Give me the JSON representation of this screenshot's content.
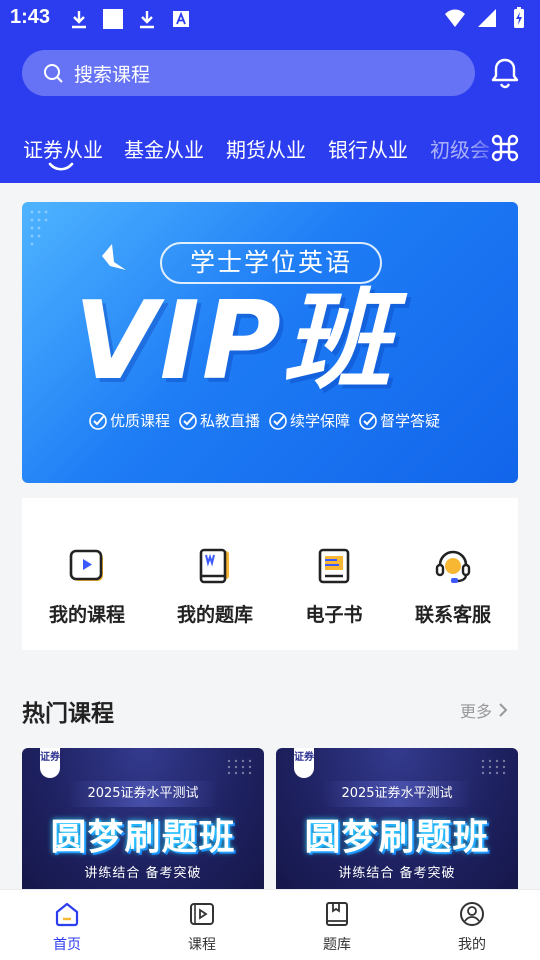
{
  "status_bar": {
    "time": "1:43",
    "left_icons": [
      "download-icon",
      "square-icon",
      "download-icon",
      "a-icon"
    ],
    "right_icons": [
      "wifi-icon",
      "signal-icon",
      "battery-charging-icon"
    ]
  },
  "search": {
    "placeholder": "搜索课程",
    "icon": "search-icon"
  },
  "notification_icon": "bell-icon",
  "category_tabs": [
    {
      "label": "证券从业",
      "active": true
    },
    {
      "label": "基金从业",
      "active": false
    },
    {
      "label": "期货从业",
      "active": false
    },
    {
      "label": "银行从业",
      "active": false
    },
    {
      "label": "初级会",
      "active": false
    }
  ],
  "all_categories_icon": "command-grid-icon",
  "banner": {
    "pill_text": "学士学位英语",
    "main_text": "VIP班",
    "features": [
      "优质课程",
      "私教直播",
      "续学保障",
      "督学答疑"
    ]
  },
  "quick_links": [
    {
      "label": "我的课程",
      "icon": "video-course-icon"
    },
    {
      "label": "我的题库",
      "icon": "question-book-icon"
    },
    {
      "label": "电子书",
      "icon": "ebook-icon"
    },
    {
      "label": "联系客服",
      "icon": "headset-icon"
    }
  ],
  "hot_courses": {
    "title": "热门课程",
    "more_label": "更多",
    "items": [
      {
        "tag": "证券",
        "subtitle": "2025证券水平测试",
        "title": "圆梦刷题班",
        "footer": "讲练结合  备考突破"
      },
      {
        "tag": "证券",
        "subtitle": "2025证券水平测试",
        "title": "圆梦刷题班",
        "footer": "讲练结合  备考突破"
      }
    ]
  },
  "bottom_nav": [
    {
      "label": "首页",
      "icon": "home-icon",
      "active": true
    },
    {
      "label": "课程",
      "icon": "course-icon",
      "active": false
    },
    {
      "label": "题库",
      "icon": "question-bank-icon",
      "active": false
    },
    {
      "label": "我的",
      "icon": "profile-icon",
      "active": false
    }
  ],
  "colors": {
    "primary": "#2c3df0",
    "banner_blue": "#1e7cf5",
    "card_dark": "#1e2160"
  }
}
